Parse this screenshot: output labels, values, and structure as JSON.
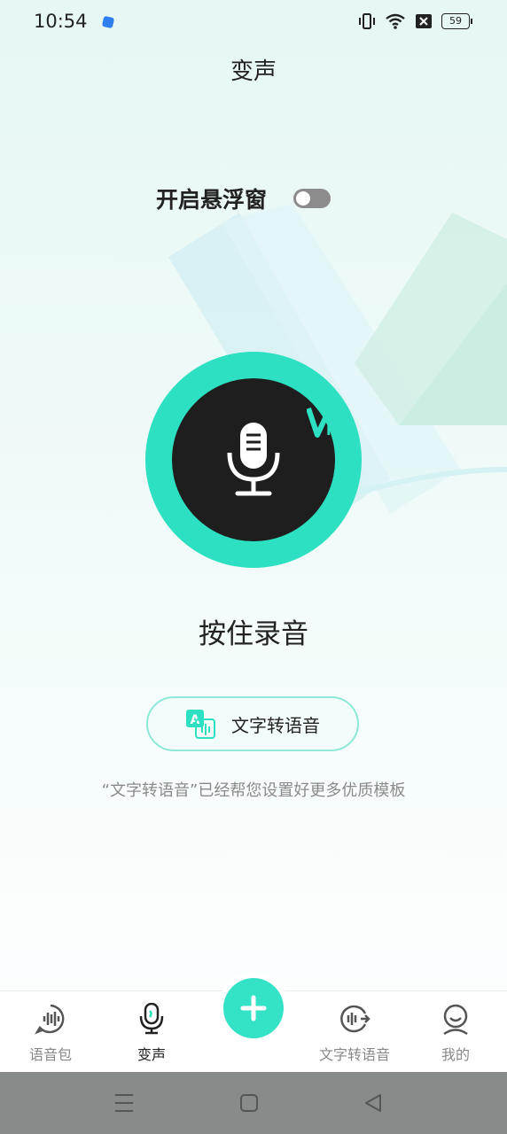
{
  "status_bar": {
    "time": "10:54",
    "battery": "59",
    "icons": [
      "vibrate-icon",
      "wifi-icon",
      "no-sim-icon",
      "battery-icon"
    ]
  },
  "header": {
    "title": "变声"
  },
  "floating_window": {
    "label": "开启悬浮窗",
    "enabled": false
  },
  "record": {
    "label": "按住录音",
    "badge": "VIP"
  },
  "tts_button": {
    "label": "文字转语音"
  },
  "hint": "“文字转语音”已经帮您设置好更多优质模板",
  "tabbar": {
    "items": [
      {
        "label": "语音包",
        "icon": "voice-pack-icon",
        "active": false
      },
      {
        "label": "变声",
        "icon": "microphone-icon",
        "active": true
      },
      {
        "label": "文字转语音",
        "icon": "text-to-speech-icon",
        "active": false
      },
      {
        "label": "我的",
        "icon": "profile-icon",
        "active": false
      }
    ],
    "fab_icon": "plus-icon"
  },
  "colors": {
    "accent": "#2ee0c2",
    "mic_bg": "#1e1e1e",
    "toggle_off": "#8c8c8c",
    "navbar": "#878b8a"
  }
}
